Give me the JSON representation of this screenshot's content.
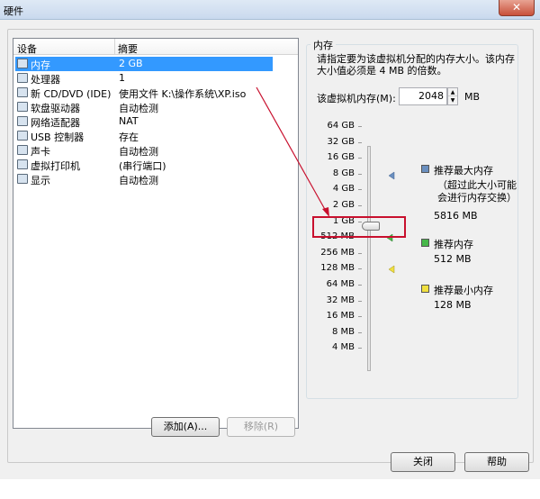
{
  "window": {
    "title": "硬件",
    "close_symbol": "✕"
  },
  "device_list": {
    "headers": [
      "设备",
      "摘要"
    ],
    "selected_index": 0,
    "items": [
      {
        "name": "内存",
        "summary": "2 GB",
        "icon": "memory-icon"
      },
      {
        "name": "处理器",
        "summary": "1",
        "icon": "processor-icon"
      },
      {
        "name": "新 CD/DVD (IDE)",
        "summary": "使用文件 K:\\操作系统\\XP.iso",
        "icon": "cd-dvd-icon"
      },
      {
        "name": "软盘驱动器",
        "summary": "自动检测",
        "icon": "floppy-icon"
      },
      {
        "name": "网络适配器",
        "summary": "NAT",
        "icon": "network-adapter-icon"
      },
      {
        "name": "USB 控制器",
        "summary": "存在",
        "icon": "usb-icon"
      },
      {
        "name": "声卡",
        "summary": "自动检测",
        "icon": "sound-card-icon"
      },
      {
        "name": "虚拟打印机",
        "summary": "(串行端口)",
        "icon": "printer-icon"
      },
      {
        "name": "显示",
        "summary": "自动检测",
        "icon": "display-icon"
      }
    ]
  },
  "buttons": {
    "add": "添加(A)...",
    "remove": "移除(R)",
    "close": "关闭",
    "help": "帮助"
  },
  "memory": {
    "group_title": "内存",
    "description": "请指定要为该虚拟机分配的内存大小。该内存大小值必须是 4 MB 的倍数。",
    "field_label": "该虚拟机内存(M):",
    "value": "2048",
    "unit": "MB",
    "scale": [
      "64 GB",
      "32 GB",
      "16 GB",
      "8 GB",
      "4 GB",
      "2 GB",
      "1 GB",
      "512 MB",
      "256 MB",
      "128 MB",
      "64 MB",
      "32 MB",
      "16 MB",
      "8 MB",
      "4 MB"
    ],
    "slider_value": "2 GB",
    "legend": [
      {
        "label": "推荐最大内存",
        "note": "（超过此大小可能会进行内存交换）",
        "value": "5816 MB",
        "color": "#6a8fbf"
      },
      {
        "label": "推荐内存",
        "value": "512 MB",
        "color": "#47b84a"
      },
      {
        "label": "推荐最小内存",
        "value": "128 MB",
        "color": "#f0e040"
      }
    ]
  }
}
